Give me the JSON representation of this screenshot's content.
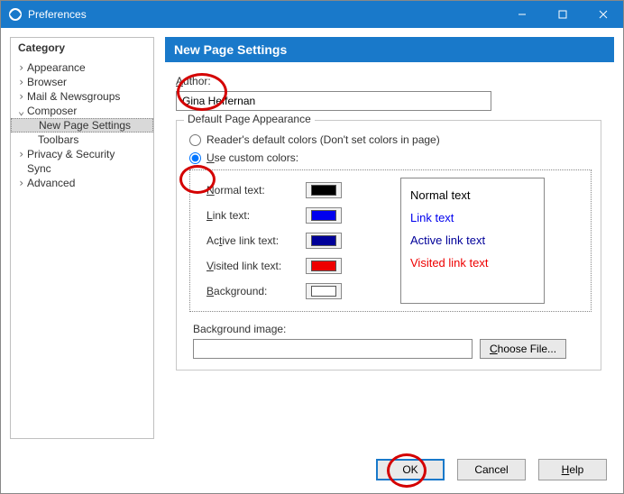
{
  "window": {
    "title": "Preferences"
  },
  "sidebar": {
    "header": "Category",
    "items": [
      {
        "label": "Appearance",
        "expandable": true,
        "expanded": false
      },
      {
        "label": "Browser",
        "expandable": true,
        "expanded": false
      },
      {
        "label": "Mail & Newsgroups",
        "expandable": true,
        "expanded": false
      },
      {
        "label": "Composer",
        "expandable": true,
        "expanded": true
      },
      {
        "label": "New Page Settings",
        "level": 2,
        "selected": true
      },
      {
        "label": "Toolbars",
        "level": 2
      },
      {
        "label": "Privacy & Security",
        "expandable": true,
        "expanded": false
      },
      {
        "label": "Sync",
        "level": 1,
        "leaf": true
      },
      {
        "label": "Advanced",
        "expandable": true,
        "expanded": false
      }
    ]
  },
  "panel": {
    "title": "New Page Settings",
    "author": {
      "label": "Author:",
      "value": "Gina Heffernan"
    },
    "appearance": {
      "legend": "Default Page Appearance",
      "radio_default": "Reader's default colors (Don't set colors in page)",
      "radio_custom": "Use custom colors:",
      "selected": "custom",
      "colors": {
        "normal": {
          "label": "Normal text:",
          "value": "#000000"
        },
        "link": {
          "label": "Link text:",
          "value": "#0000ee"
        },
        "active": {
          "label": "Active link text:",
          "value": "#000099"
        },
        "visited": {
          "label": "Visited link text:",
          "value": "#ee0000"
        },
        "background": {
          "label": "Background:",
          "value": "#ffffff"
        }
      },
      "preview": {
        "normal": "Normal text",
        "link": "Link text",
        "active": "Active link text",
        "visited": "Visited link text"
      },
      "bg_image_label": "Background image:",
      "bg_image_value": "",
      "choose_file": "Choose File..."
    }
  },
  "buttons": {
    "ok": "OK",
    "cancel": "Cancel",
    "help": "Help"
  }
}
